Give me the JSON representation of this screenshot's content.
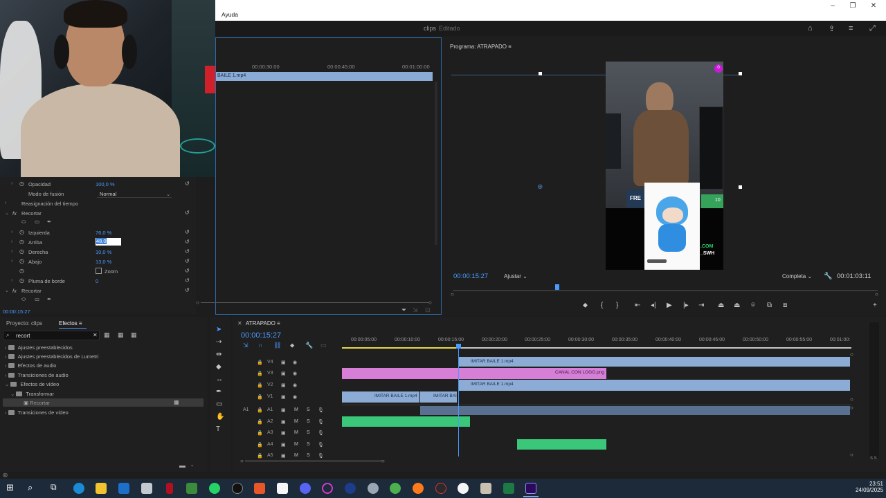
{
  "menubar": {
    "help": "Ayuda"
  },
  "header": {
    "project": "clips",
    "status": "Editado"
  },
  "source_monitor": {
    "ruler": [
      "00:00:30:00",
      "00:00:45:00",
      "00:01:00:00"
    ],
    "clip": "BAILE 1.mp4"
  },
  "effect_controls": {
    "opacity_label": "Opacidad",
    "opacity_value": "100,0 %",
    "blend_label": "Modo de fusión",
    "blend_value": "Normal",
    "time_remap": "Reasignación del tiempo",
    "crop1": "Recortar",
    "left_label": "Izquierda",
    "left_value": "76,0 %",
    "top_label": "Arriba",
    "top_value": "48,0",
    "right_label": "Derecha",
    "right_value": "10,0 %",
    "bottom_label": "Abajo",
    "bottom_value": "13,0 %",
    "zoom_label": "Zoom",
    "feather_label": "Pluma de borde",
    "feather_value": "0",
    "crop2": "Recortar",
    "timecode": "00:00:15:27"
  },
  "program_monitor": {
    "title": "Programa: ATRAPADO",
    "timecode": "00:00:15:27",
    "fit": "Ajustar",
    "resolution": "Completa",
    "duration": "00:01:03:11",
    "badge": "0",
    "overlay_left": "FRE",
    "overlay_right1": ".COM",
    "overlay_right2": "_SWH",
    "overlay_chip": "10"
  },
  "project_panel": {
    "tab_project": "Proyecto: clips",
    "tab_effects": "Efectos",
    "search": "recort",
    "tree": [
      "Ajustes preestablecidos",
      "Ajustes preestablecidos de Lumetri",
      "Efectos de audio",
      "Transiciones de audio",
      "Efectos de vídeo",
      "Transformar",
      "Recortar",
      "Transiciones de vídeo"
    ]
  },
  "timeline": {
    "title": "ATRAPADO",
    "timecode": "00:00:15:27",
    "ruler": [
      "00:00:05:00",
      "00:00:10:00",
      "00:00:15:00",
      "00:00:20:00",
      "00:00:25:00",
      "00:00:30:00",
      "00:00:35:00",
      "00:00:40:00",
      "00:00:45:00",
      "00:00:50:00",
      "00:00:55:00",
      "00:01:00:"
    ],
    "tracks": [
      "V4",
      "V3",
      "V2",
      "V1",
      "A1",
      "A2",
      "A3",
      "A4",
      "A5"
    ],
    "src_patch": "A1",
    "mute": "M",
    "solo": "S",
    "meter": "S S",
    "clips": {
      "v4": "IMITAR BAILE 1.mp4",
      "v3": "CANAL CON LOGO.png",
      "v2": "IMITAR BAILE 1.mp4",
      "v1a": "IMITAR BAILE 1.mp4",
      "v1b": "IMITAR BAI"
    }
  },
  "taskbar": {
    "time": "23:51",
    "date": "24/09/2025"
  }
}
